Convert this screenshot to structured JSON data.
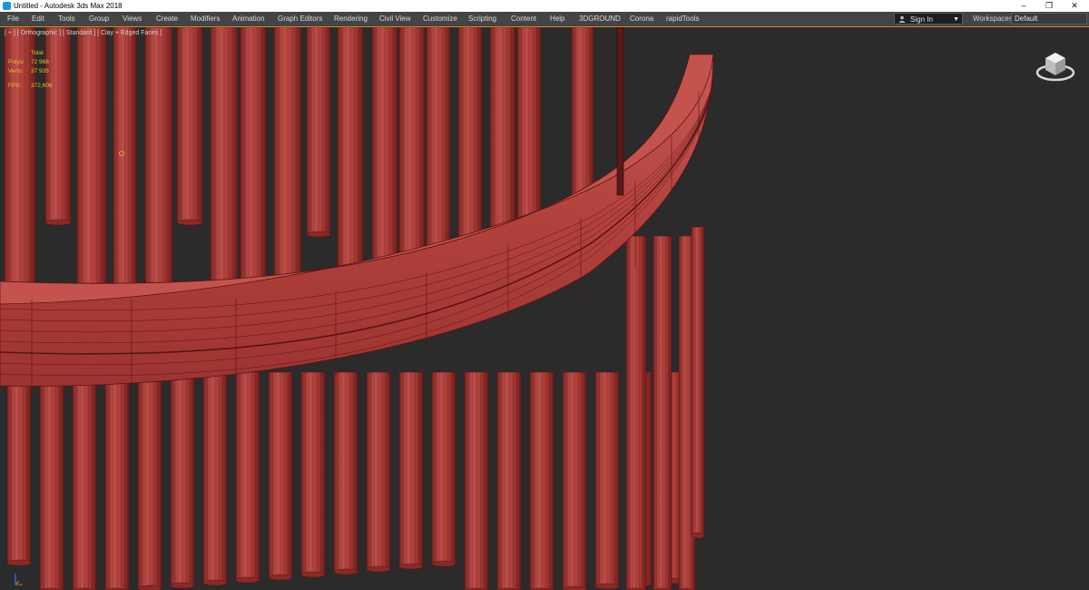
{
  "window": {
    "title": "Untitled - Autodesk 3ds Max 2018",
    "controls": {
      "minimize": "–",
      "restore": "❐",
      "close": "✕"
    }
  },
  "menubar": {
    "items": [
      "File",
      "Edit",
      "Tools",
      "Group",
      "Views",
      "Create",
      "Modifiers",
      "Animation",
      "Graph Editors",
      "Rendering",
      "Civil View",
      "Customize",
      "Scripting",
      "Content",
      "Help",
      "3DGROUND",
      "Corona",
      "rapidTools"
    ],
    "signin": {
      "label": "Sign In",
      "icon": "user-icon",
      "caret": "▼"
    },
    "workspaces": {
      "label": "Workspaces:",
      "value": "Default"
    }
  },
  "viewport": {
    "label": "[ + ] [ Orthographic ] [ Standard ] [ Clay + Edged Faces ]",
    "stats": {
      "header": "Total",
      "rows": [
        {
          "key": "Polys:",
          "value": "72 968"
        },
        {
          "key": "Verts:",
          "value": "37 935"
        },
        {
          "key": "FPS:",
          "value": "372,606"
        }
      ]
    },
    "viewcube_icon": "viewcube-icon"
  },
  "colors": {
    "clay": "#b2413d",
    "clay_dark": "#8a2a27",
    "edge": "#5a1414",
    "background": "#2b2b2b",
    "menubar": "#444444",
    "stats_text": "#e0c232"
  }
}
